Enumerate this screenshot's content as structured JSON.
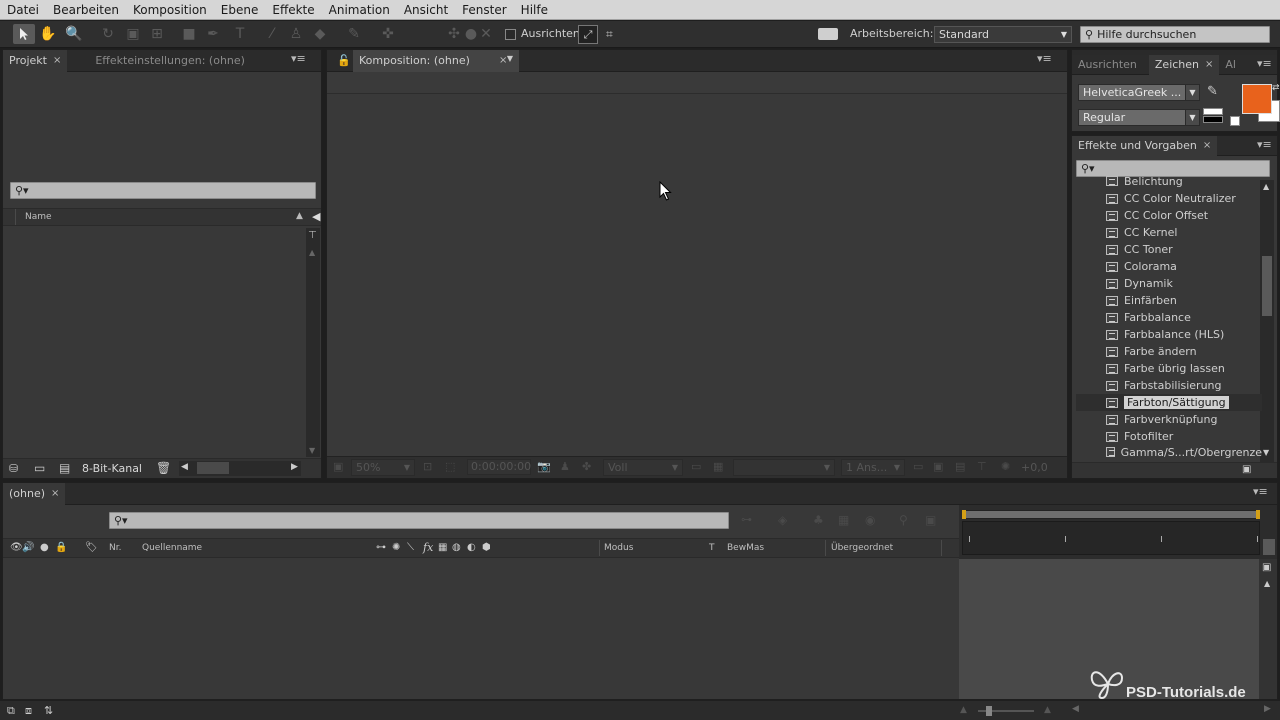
{
  "menu": [
    "Datei",
    "Bearbeiten",
    "Komposition",
    "Ebene",
    "Effekte",
    "Animation",
    "Ansicht",
    "Fenster",
    "Hilfe"
  ],
  "toolbar": {
    "align_label": "Ausrichten",
    "workspace_label": "Arbeitsbereich:",
    "workspace_value": "Standard",
    "help_search_placeholder": "Hilfe durchsuchen"
  },
  "project_panel": {
    "tab_project": "Projekt",
    "tab_effect_controls": "Effekteinstellungen: (ohne)",
    "col_name": "Name",
    "bit_depth": "8-Bit-Kanal"
  },
  "comp_panel": {
    "tab_label": "Komposition: (ohne)",
    "zoom": "50%",
    "timecode": "0:00:00:00",
    "resolution": "Voll",
    "views": "1 Ans...",
    "exposure": "+0,0"
  },
  "right_panel": {
    "tab_align": "Ausrichten",
    "tab_character": "Zeichen",
    "tab_ai": "Al",
    "font_family": "HelveticaGreek ...",
    "font_style": "Regular",
    "fill_color": "#e8621c"
  },
  "effects_panel": {
    "tab_label": "Effekte und Vorgaben",
    "items": [
      "Belichtung",
      "CC Color Neutralizer",
      "CC Color Offset",
      "CC Kernel",
      "CC Toner",
      "Colorama",
      "Dynamik",
      "Einfärben",
      "Farbbalance",
      "Farbbalance (HLS)",
      "Farbe ändern",
      "Farbe übrig lassen",
      "Farbstabilisierung",
      "Farbton/Sättigung",
      "Farbverknüpfung",
      "Fotofilter",
      "Gamma/S...rt/Obergrenze"
    ],
    "selected": "Farbton/Sättigung"
  },
  "timeline": {
    "tab_label": "(ohne)",
    "col_nr": "Nr.",
    "col_source": "Quellenname",
    "col_mode": "Modus",
    "col_t": "T",
    "col_trkmat": "BewMas",
    "col_parent": "Übergeordnet",
    "fx_label": "fx"
  },
  "watermark": "PSD-Tutorials.de"
}
